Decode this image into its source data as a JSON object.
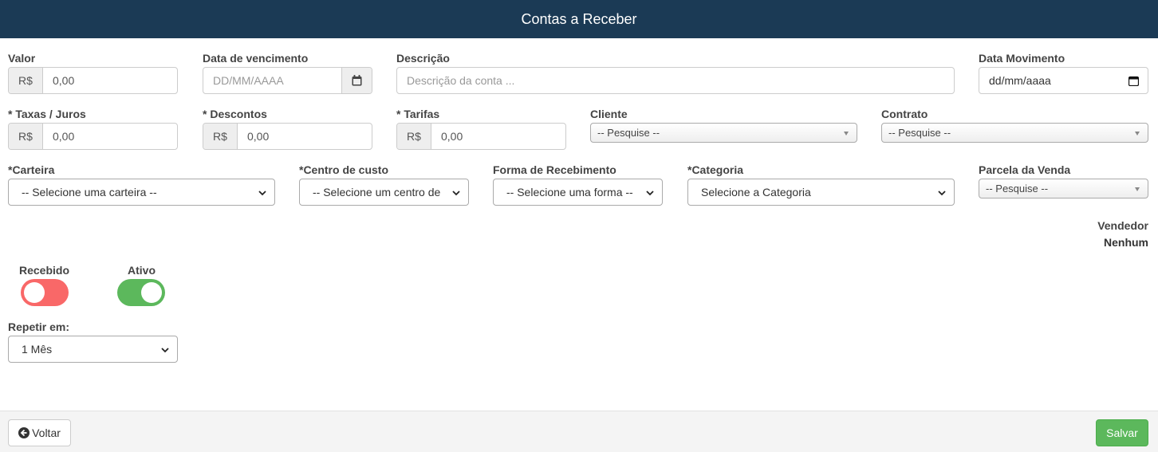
{
  "header": {
    "title": "Contas a Receber"
  },
  "currency_symbol": "R$",
  "fields": {
    "valor": {
      "label": "Valor",
      "value": "0,00"
    },
    "data_vencimento": {
      "label": "Data de vencimento",
      "placeholder": "DD/MM/AAAA",
      "icon": "calendar-icon"
    },
    "descricao": {
      "label": "Descrição",
      "placeholder": "Descrição da conta ..."
    },
    "data_movimento": {
      "label": "Data Movimento",
      "placeholder": "dd/mm/aaaa",
      "icon": "calendar-icon"
    },
    "taxas": {
      "label": "* Taxas / Juros",
      "value": "0,00"
    },
    "descontos": {
      "label": "* Descontos",
      "value": "0,00"
    },
    "tarifas": {
      "label": "* Tarifas",
      "value": "0,00"
    },
    "cliente": {
      "label": "Cliente",
      "value": "-- Pesquise --"
    },
    "contrato": {
      "label": "Contrato",
      "value": "-- Pesquise --"
    },
    "carteira": {
      "label": "*Carteira",
      "value": "-- Selecione uma carteira --"
    },
    "centro_custo": {
      "label": "*Centro de custo",
      "value": "-- Selecione um centro de"
    },
    "forma_recebimento": {
      "label": "Forma de Recebimento",
      "value": "-- Selecione uma forma --"
    },
    "categoria": {
      "label": "*Categoria",
      "value": "Selecione a Categoria"
    },
    "parcela_venda": {
      "label": "Parcela da Venda",
      "value": "-- Pesquise --"
    },
    "repetir": {
      "label": "Repetir em:",
      "value": "1 Mês"
    }
  },
  "vendedor": {
    "label": "Vendedor",
    "value": "Nenhum"
  },
  "toggles": {
    "recebido": {
      "label": "Recebido",
      "on": false,
      "color": "#f96868"
    },
    "ativo": {
      "label": "Ativo",
      "on": true,
      "color": "#5cb85c"
    }
  },
  "footer": {
    "back_label": "Voltar",
    "back_icon": "arrow-left-circle-icon",
    "save_label": "Salvar"
  },
  "colors": {
    "header_bg": "#1b3a55",
    "save_green": "#5cb85c"
  }
}
